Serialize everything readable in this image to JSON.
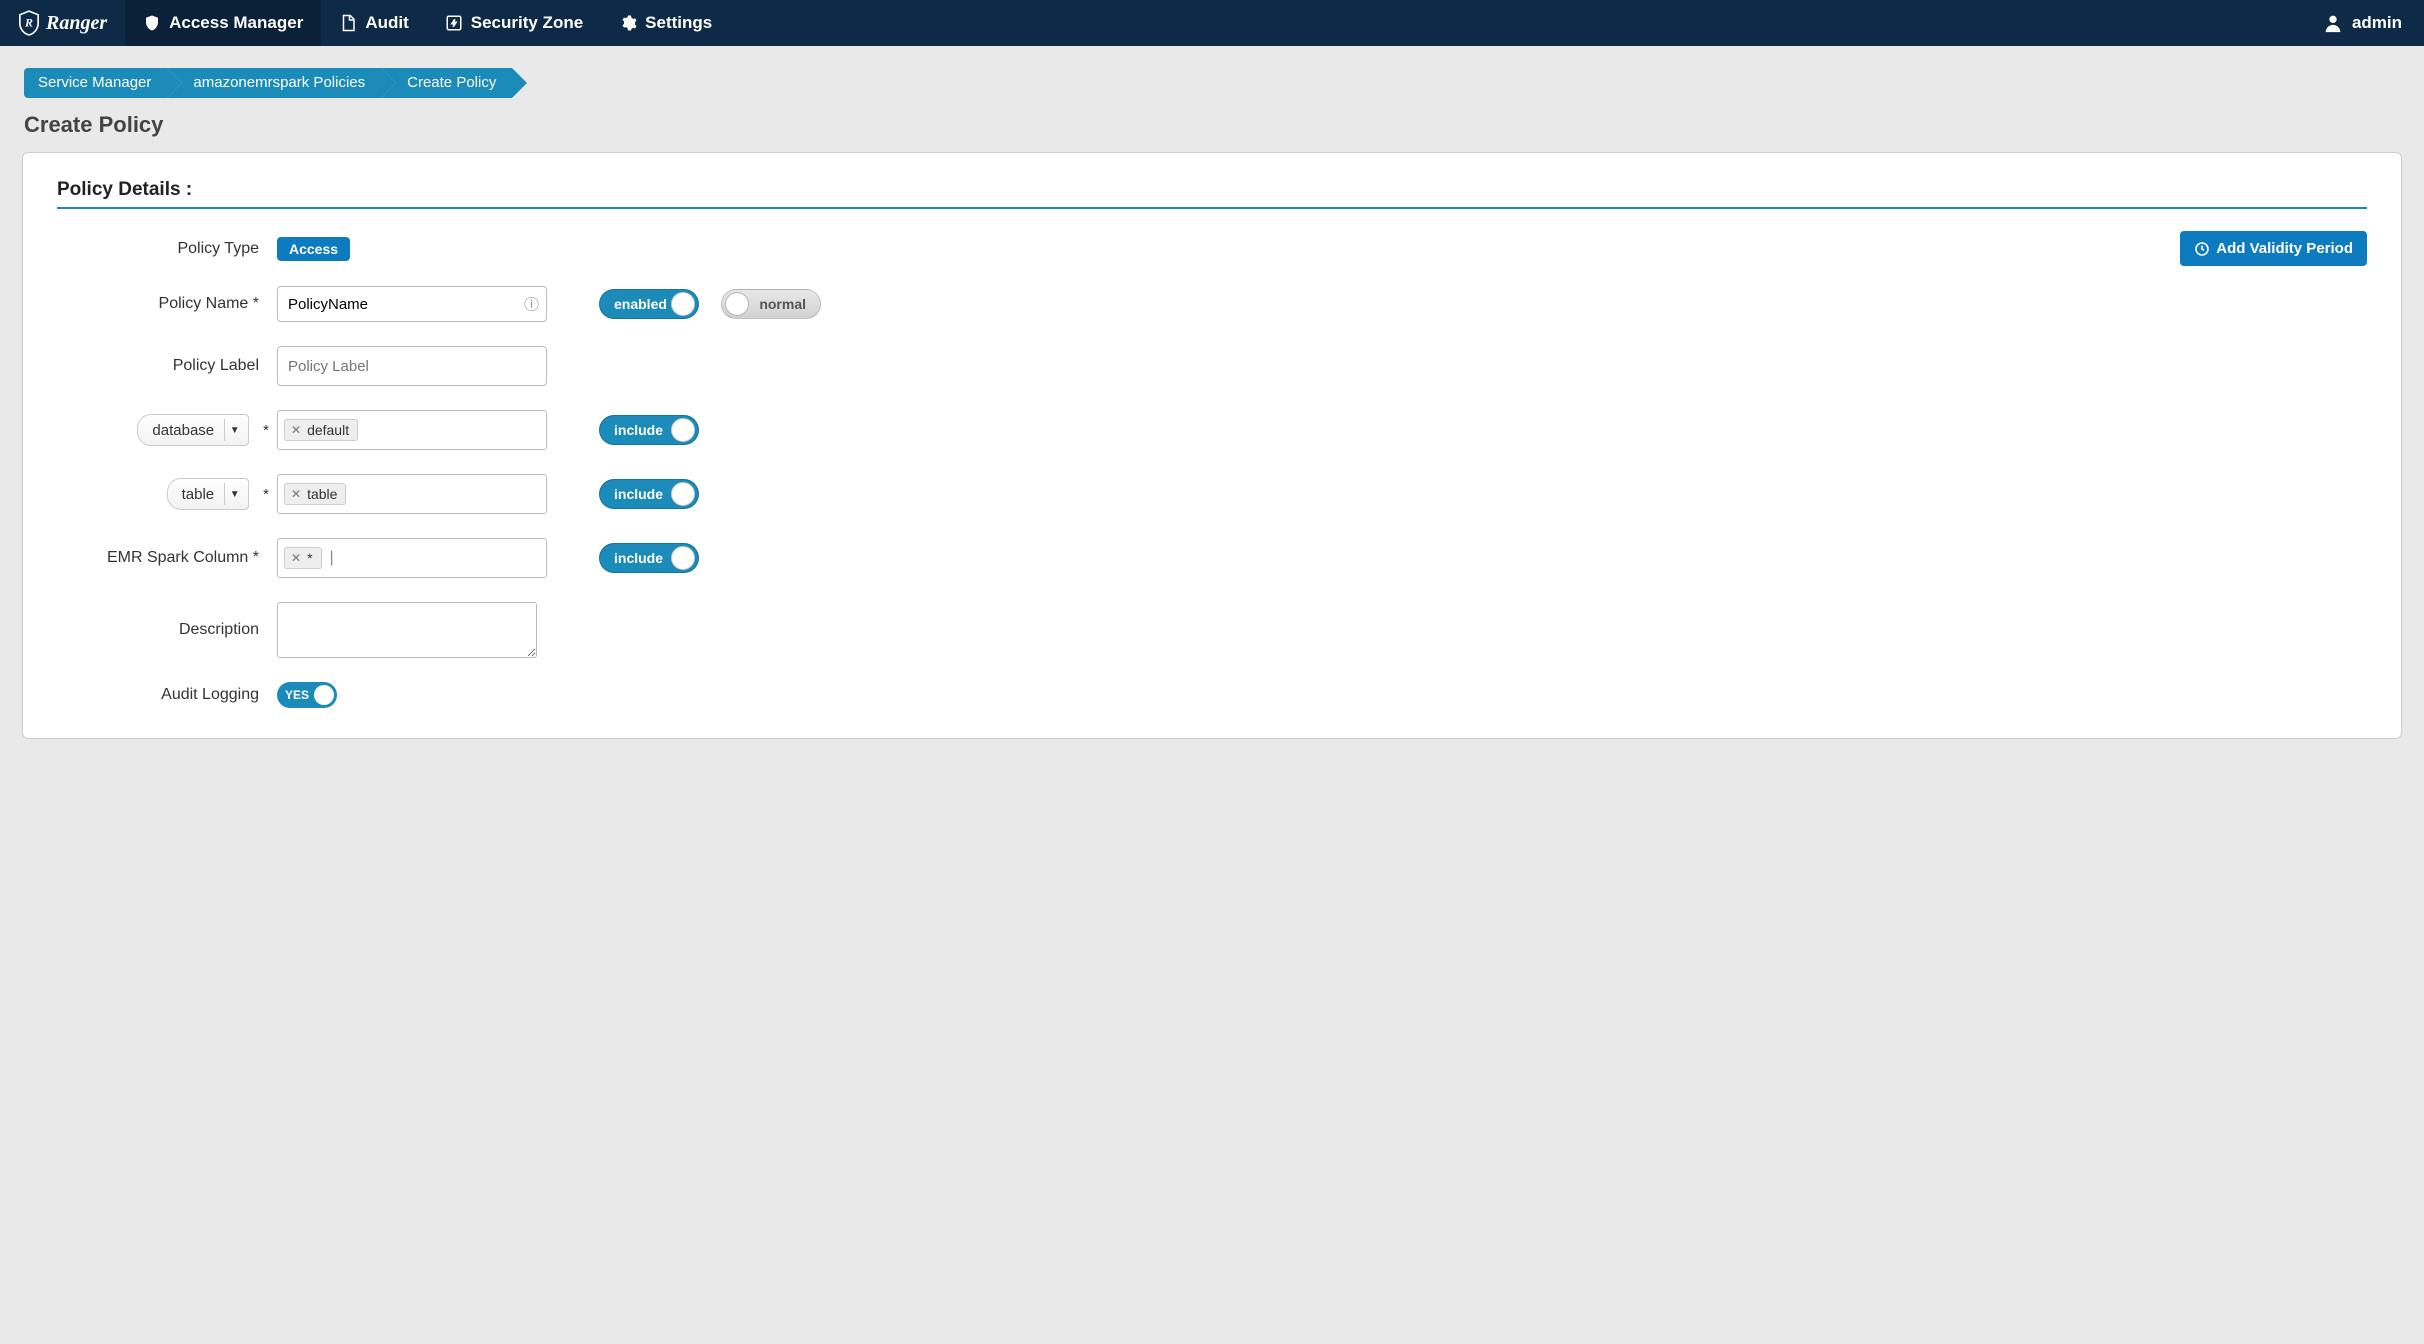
{
  "brand": "Ranger",
  "nav": {
    "access": "Access Manager",
    "audit": "Audit",
    "security": "Security Zone",
    "settings": "Settings"
  },
  "user": "admin",
  "breadcrumbs": [
    "Service Manager",
    "amazonemrspark Policies",
    "Create Policy"
  ],
  "page_title": "Create Policy",
  "section_title": "Policy Details :",
  "labels": {
    "policy_type": "Policy Type",
    "policy_name": "Policy Name *",
    "policy_label": "Policy Label",
    "database": "database",
    "table": "table",
    "emr_col": "EMR Spark Column *",
    "description": "Description",
    "audit": "Audit Logging"
  },
  "policy_type_value": "Access",
  "validity_btn": "Add Validity Period",
  "policy_name_value": "PolicyName",
  "toggles": {
    "enabled": "enabled",
    "normal": "normal",
    "include": "include",
    "yes": "YES"
  },
  "placeholders": {
    "policy_label": "Policy Label"
  },
  "tags": {
    "database": "default",
    "table": "table",
    "column": "*"
  },
  "req_mark": "*"
}
